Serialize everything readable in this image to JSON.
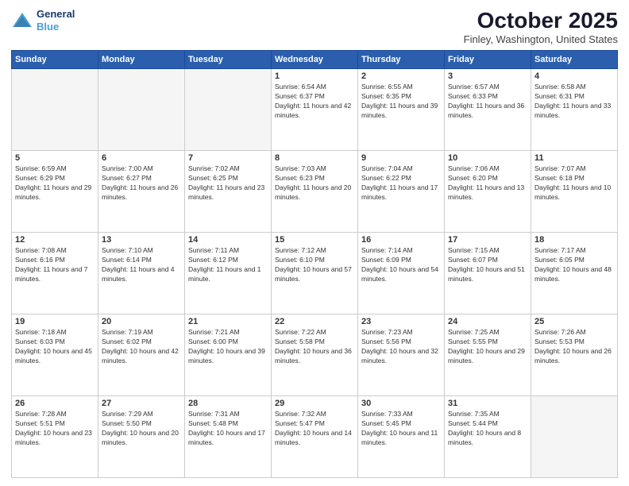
{
  "header": {
    "logo": {
      "line1": "General",
      "line2": "Blue"
    },
    "title": "October 2025",
    "subtitle": "Finley, Washington, United States"
  },
  "days_of_week": [
    "Sunday",
    "Monday",
    "Tuesday",
    "Wednesday",
    "Thursday",
    "Friday",
    "Saturday"
  ],
  "weeks": [
    [
      {
        "day": "",
        "info": ""
      },
      {
        "day": "",
        "info": ""
      },
      {
        "day": "",
        "info": ""
      },
      {
        "day": "1",
        "info": "Sunrise: 6:54 AM\nSunset: 6:37 PM\nDaylight: 11 hours and 42 minutes."
      },
      {
        "day": "2",
        "info": "Sunrise: 6:55 AM\nSunset: 6:35 PM\nDaylight: 11 hours and 39 minutes."
      },
      {
        "day": "3",
        "info": "Sunrise: 6:57 AM\nSunset: 6:33 PM\nDaylight: 11 hours and 36 minutes."
      },
      {
        "day": "4",
        "info": "Sunrise: 6:58 AM\nSunset: 6:31 PM\nDaylight: 11 hours and 33 minutes."
      }
    ],
    [
      {
        "day": "5",
        "info": "Sunrise: 6:59 AM\nSunset: 6:29 PM\nDaylight: 11 hours and 29 minutes."
      },
      {
        "day": "6",
        "info": "Sunrise: 7:00 AM\nSunset: 6:27 PM\nDaylight: 11 hours and 26 minutes."
      },
      {
        "day": "7",
        "info": "Sunrise: 7:02 AM\nSunset: 6:25 PM\nDaylight: 11 hours and 23 minutes."
      },
      {
        "day": "8",
        "info": "Sunrise: 7:03 AM\nSunset: 6:23 PM\nDaylight: 11 hours and 20 minutes."
      },
      {
        "day": "9",
        "info": "Sunrise: 7:04 AM\nSunset: 6:22 PM\nDaylight: 11 hours and 17 minutes."
      },
      {
        "day": "10",
        "info": "Sunrise: 7:06 AM\nSunset: 6:20 PM\nDaylight: 11 hours and 13 minutes."
      },
      {
        "day": "11",
        "info": "Sunrise: 7:07 AM\nSunset: 6:18 PM\nDaylight: 11 hours and 10 minutes."
      }
    ],
    [
      {
        "day": "12",
        "info": "Sunrise: 7:08 AM\nSunset: 6:16 PM\nDaylight: 11 hours and 7 minutes."
      },
      {
        "day": "13",
        "info": "Sunrise: 7:10 AM\nSunset: 6:14 PM\nDaylight: 11 hours and 4 minutes."
      },
      {
        "day": "14",
        "info": "Sunrise: 7:11 AM\nSunset: 6:12 PM\nDaylight: 11 hours and 1 minute."
      },
      {
        "day": "15",
        "info": "Sunrise: 7:12 AM\nSunset: 6:10 PM\nDaylight: 10 hours and 57 minutes."
      },
      {
        "day": "16",
        "info": "Sunrise: 7:14 AM\nSunset: 6:09 PM\nDaylight: 10 hours and 54 minutes."
      },
      {
        "day": "17",
        "info": "Sunrise: 7:15 AM\nSunset: 6:07 PM\nDaylight: 10 hours and 51 minutes."
      },
      {
        "day": "18",
        "info": "Sunrise: 7:17 AM\nSunset: 6:05 PM\nDaylight: 10 hours and 48 minutes."
      }
    ],
    [
      {
        "day": "19",
        "info": "Sunrise: 7:18 AM\nSunset: 6:03 PM\nDaylight: 10 hours and 45 minutes."
      },
      {
        "day": "20",
        "info": "Sunrise: 7:19 AM\nSunset: 6:02 PM\nDaylight: 10 hours and 42 minutes."
      },
      {
        "day": "21",
        "info": "Sunrise: 7:21 AM\nSunset: 6:00 PM\nDaylight: 10 hours and 39 minutes."
      },
      {
        "day": "22",
        "info": "Sunrise: 7:22 AM\nSunset: 5:58 PM\nDaylight: 10 hours and 36 minutes."
      },
      {
        "day": "23",
        "info": "Sunrise: 7:23 AM\nSunset: 5:56 PM\nDaylight: 10 hours and 32 minutes."
      },
      {
        "day": "24",
        "info": "Sunrise: 7:25 AM\nSunset: 5:55 PM\nDaylight: 10 hours and 29 minutes."
      },
      {
        "day": "25",
        "info": "Sunrise: 7:26 AM\nSunset: 5:53 PM\nDaylight: 10 hours and 26 minutes."
      }
    ],
    [
      {
        "day": "26",
        "info": "Sunrise: 7:28 AM\nSunset: 5:51 PM\nDaylight: 10 hours and 23 minutes."
      },
      {
        "day": "27",
        "info": "Sunrise: 7:29 AM\nSunset: 5:50 PM\nDaylight: 10 hours and 20 minutes."
      },
      {
        "day": "28",
        "info": "Sunrise: 7:31 AM\nSunset: 5:48 PM\nDaylight: 10 hours and 17 minutes."
      },
      {
        "day": "29",
        "info": "Sunrise: 7:32 AM\nSunset: 5:47 PM\nDaylight: 10 hours and 14 minutes."
      },
      {
        "day": "30",
        "info": "Sunrise: 7:33 AM\nSunset: 5:45 PM\nDaylight: 10 hours and 11 minutes."
      },
      {
        "day": "31",
        "info": "Sunrise: 7:35 AM\nSunset: 5:44 PM\nDaylight: 10 hours and 8 minutes."
      },
      {
        "day": "",
        "info": ""
      }
    ]
  ]
}
